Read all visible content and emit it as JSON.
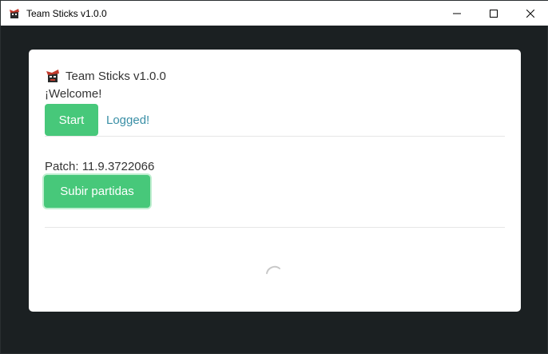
{
  "window": {
    "title": "Team Sticks v1.0.0",
    "controls": [
      "minimize-icon",
      "maximize-icon",
      "close-icon"
    ]
  },
  "app": {
    "title": "Team Sticks v1.0.0",
    "welcome": "¡Welcome!",
    "start_label": "Start",
    "logged_label": "Logged!",
    "patch_label": "Patch: 11.9.3722066",
    "upload_label": "Subir partidas"
  },
  "colors": {
    "background": "#1b2022",
    "card": "#ffffff",
    "button": "#47c87a",
    "link": "#3a8fa6"
  },
  "icons": {
    "app_logo": "team-sticks-logo-icon",
    "loading": "loading-spinner-icon"
  }
}
